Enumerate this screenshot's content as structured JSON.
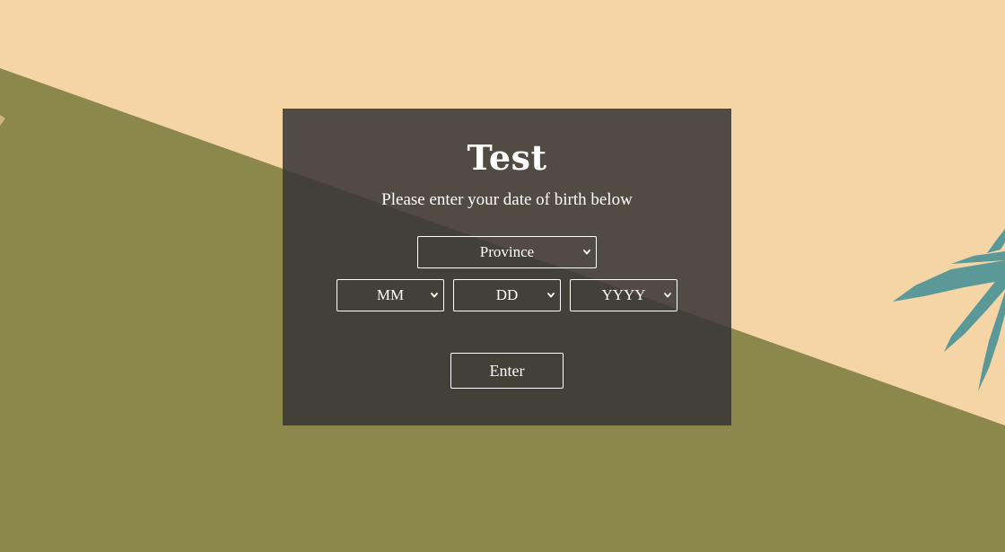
{
  "modal": {
    "title": "Test",
    "subtitle": "Please enter your date of birth below"
  },
  "form": {
    "province": {
      "selected": "Province"
    },
    "month": {
      "selected": "MM"
    },
    "day": {
      "selected": "DD"
    },
    "year": {
      "selected": "YYYY"
    },
    "enter_label": "Enter"
  },
  "colors": {
    "upper_background": "#f5d4a6",
    "lower_background": "#8c874b",
    "modal_overlay": "#373434",
    "leaf": "#3f8f95",
    "text": "#ffffff"
  },
  "icons": {
    "select_chevron": "chevron-down-icon",
    "decoration": "cannabis-leaf-icon"
  }
}
